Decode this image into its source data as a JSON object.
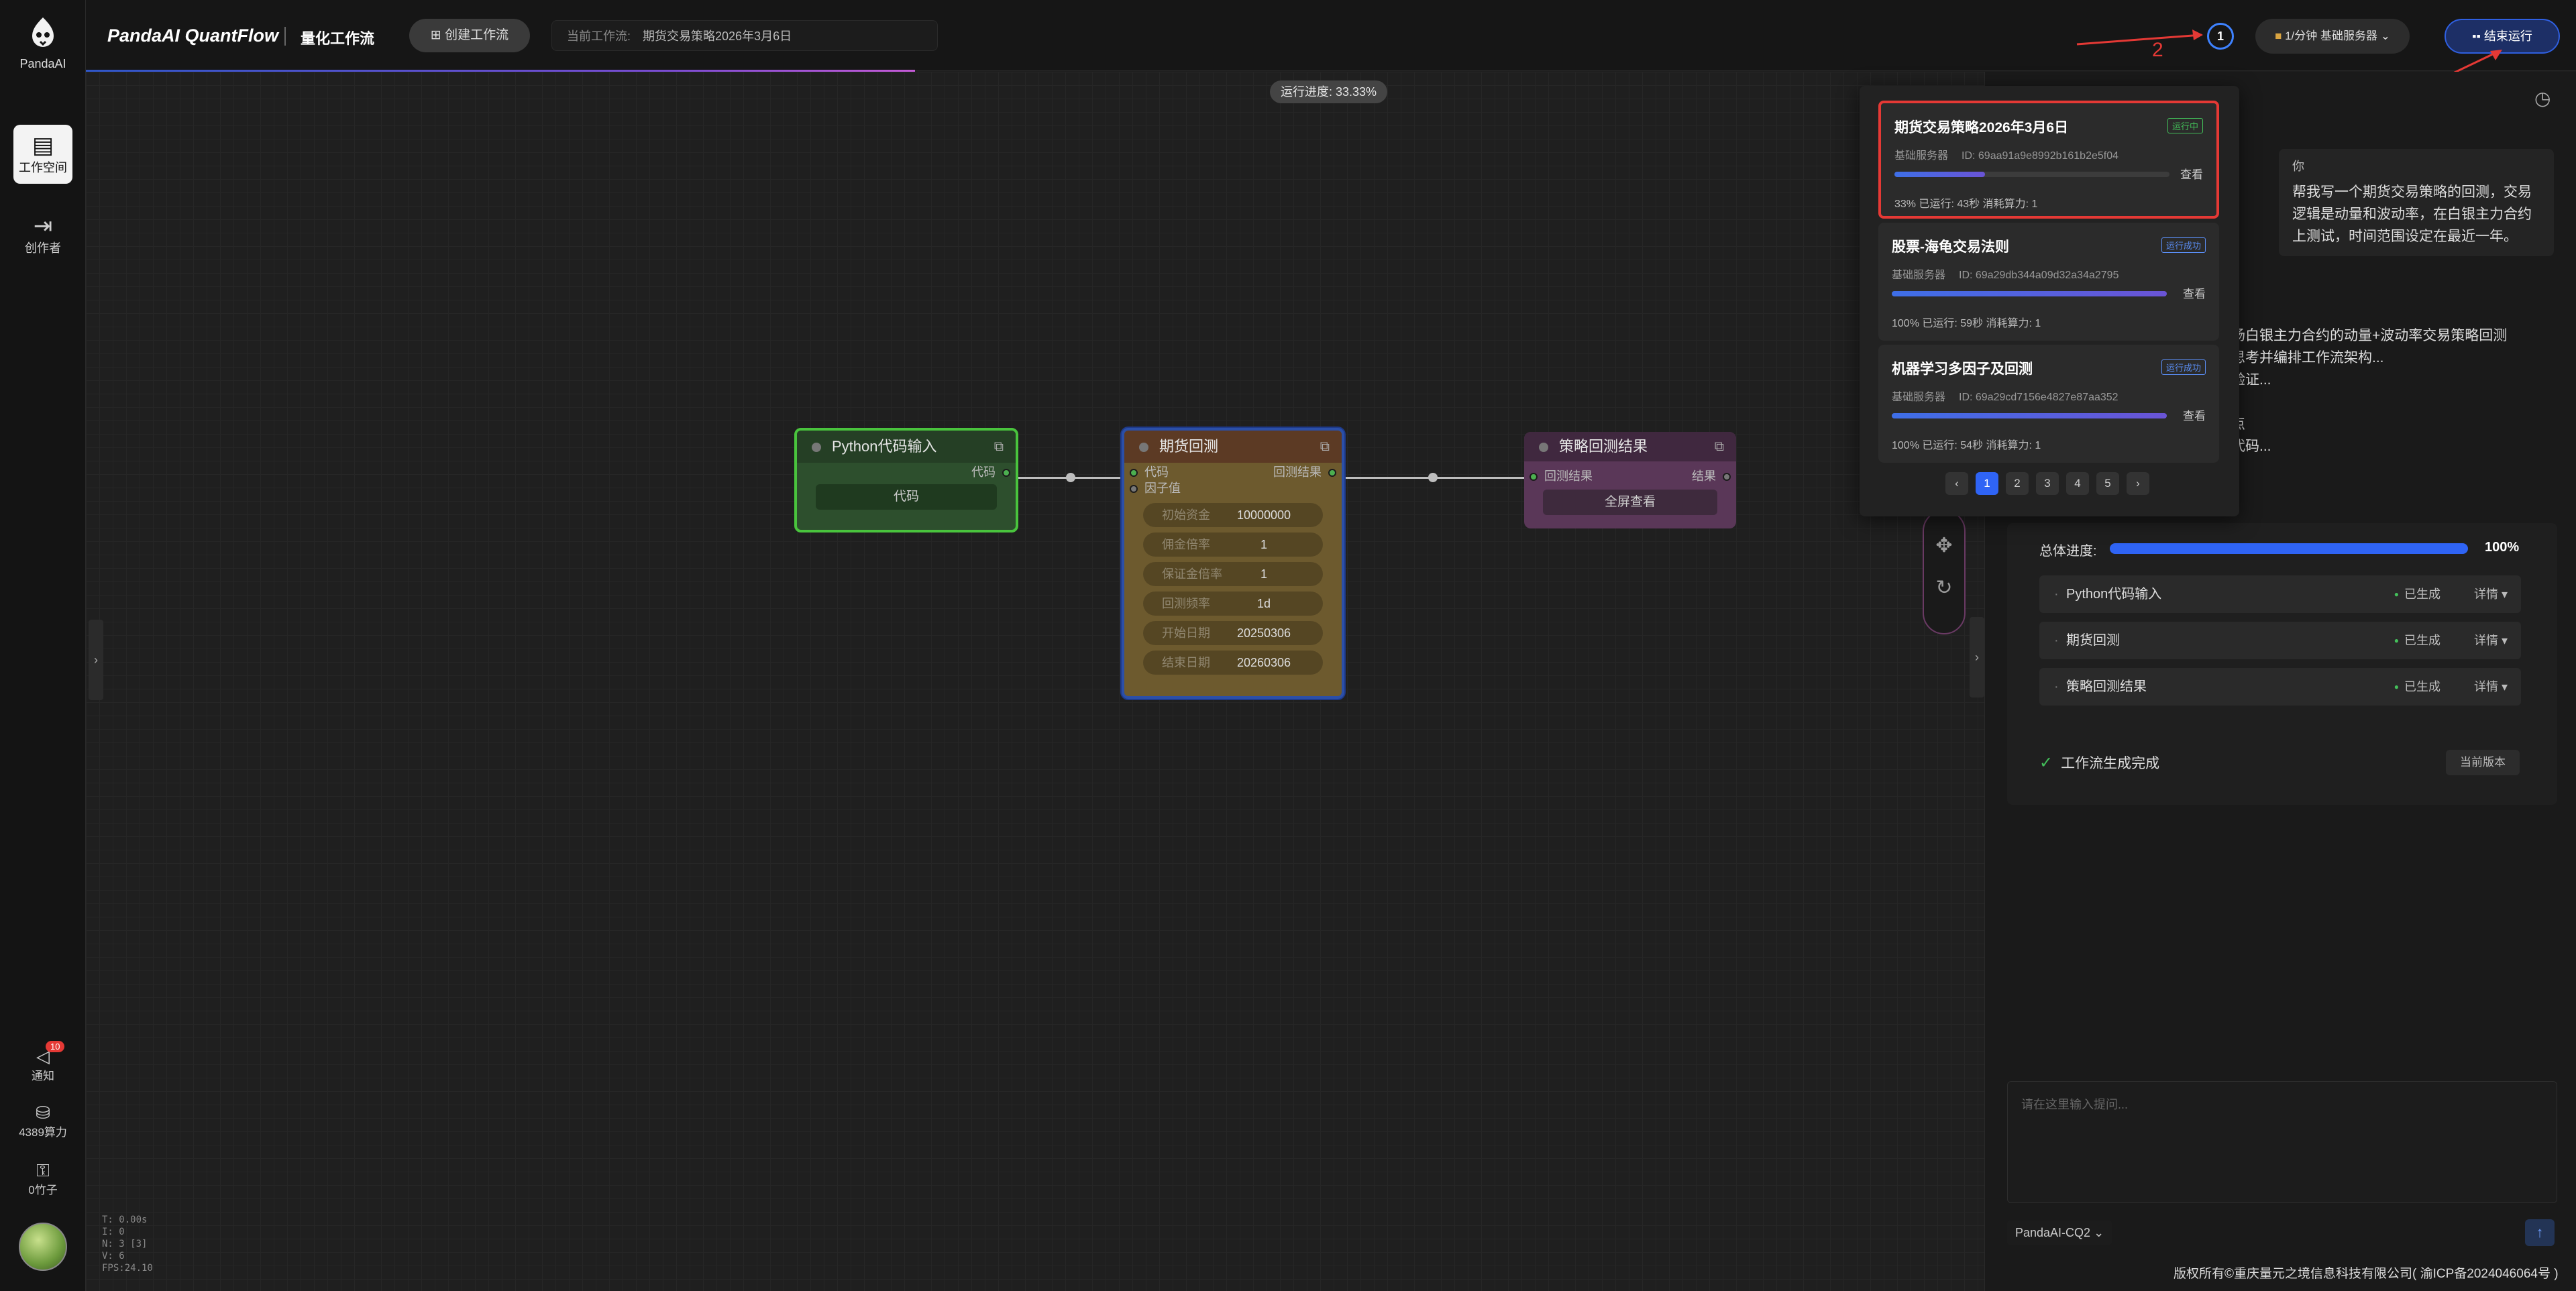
{
  "app": {
    "logo_text": "PandaAI",
    "brand": "PandaAI QuantFlow",
    "section_title": "量化工作流",
    "create_label": "创建工作流",
    "current_flow_label": "当前工作流:",
    "current_flow_name": "期货交易策略2026年3月6日"
  },
  "sidebar": {
    "workspace": "工作空间",
    "creator": "创作者",
    "notify": "通知",
    "notify_count": "10",
    "compute": "4389算力",
    "coins": "0竹子"
  },
  "topbar": {
    "run_progress": "运行进度: 33.33%",
    "running_count": "1",
    "server_label": "1/分钟  基础服务器",
    "end_label": "结束运行",
    "annot_1": "1",
    "annot_2": "2"
  },
  "nodes": {
    "python": {
      "title": "Python代码输入",
      "port_out": "代码",
      "button": "代码"
    },
    "backtest": {
      "title": "期货回测",
      "port_in_code": "代码",
      "port_in_factor": "因子值",
      "port_out": "回测结果",
      "fields": [
        {
          "key": "初始资金",
          "value": "10000000"
        },
        {
          "key": "佣金倍率",
          "value": "1"
        },
        {
          "key": "保证金倍率",
          "value": "1"
        },
        {
          "key": "回测频率",
          "value": "1d"
        },
        {
          "key": "开始日期",
          "value": "20250306"
        },
        {
          "key": "结束日期",
          "value": "20260306"
        }
      ]
    },
    "result": {
      "title": "策略回测结果",
      "port_in": "回测结果",
      "port_out": "结果",
      "button": "全屏查看"
    }
  },
  "canvas_stats": [
    "T: 0.00s",
    "I: 0",
    "N: 3 [3]",
    "V: 6",
    "FPS:24.10"
  ],
  "popup": {
    "cards": [
      {
        "title": "期货交易策略2026年3月6日",
        "status": "运行中",
        "server": "基础服务器",
        "id": "ID: 69aa91a9e8992b161b2e5f04",
        "progress": 0.33,
        "view": "查看",
        "stats": "33%  已运行: 43秒   消耗算力: 1"
      },
      {
        "title": "股票-海龟交易法则",
        "status": "运行成功",
        "server": "基础服务器",
        "id": "ID: 69a29db344a09d32a34a2795",
        "progress": 1.0,
        "view": "查看",
        "stats": "100%  已运行: 59秒   消耗算力: 1"
      },
      {
        "title": "机器学习多因子及回测",
        "status": "运行成功",
        "server": "基础服务器",
        "id": "ID: 69a29cd7156e4827e87aa352",
        "progress": 1.0,
        "view": "查看",
        "stats": "100%  已运行: 54秒   消耗算力: 1"
      }
    ],
    "pages": [
      "1",
      "2",
      "3",
      "4",
      "5"
    ],
    "prev": "‹",
    "next": "›"
  },
  "chat": {
    "user_label": "你",
    "user_message": "帮我写一个期货交易策略的回测，交易逻辑是动量和波动率，在白银主力合约上测试，时间范围设定在最近一年。",
    "ai_lines": [
      "市场白银主力合约的动量+波动率交易策略回测",
      "在思考并编排工作流架构...",
      "功验证...",
      "",
      "节点",
      "井代码..."
    ],
    "overall_label": "总体进度:",
    "overall_pct": "100%",
    "overall_progress": 1.0,
    "steps": [
      {
        "name": "Python代码输入",
        "status": "已生成",
        "detail": "详情 ▾"
      },
      {
        "name": "期货回测",
        "status": "已生成",
        "detail": "详情 ▾"
      },
      {
        "name": "策略回测结果",
        "status": "已生成",
        "detail": "详情 ▾"
      }
    ],
    "done_text": "工作流生成完成",
    "current_version": "当前版本",
    "input_placeholder": "请在这里输入提问...",
    "model": "PandaAI-CQ2"
  },
  "footer": {
    "copyright": "版权所有©重庆量元之境信息科技有限公司( 渝ICP备2024046064号 )"
  },
  "colors": {
    "accent": "#2f64f5",
    "highlight": "#e53935",
    "success": "#43c05a"
  }
}
